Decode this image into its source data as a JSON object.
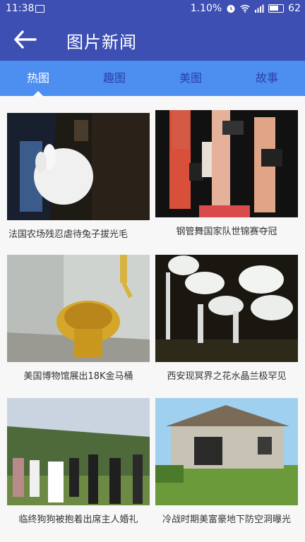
{
  "status_bar": {
    "time": "11:38",
    "network_speed": "1.10%",
    "battery_level": "62",
    "icons": [
      "image-icon",
      "alarm-icon",
      "wifi-icon",
      "signal-icon",
      "battery-icon"
    ]
  },
  "appbar": {
    "title": "图片新闻",
    "back_icon": "back-arrow-icon"
  },
  "tabs": [
    {
      "label": "热图",
      "active": true
    },
    {
      "label": "趣图",
      "active": false
    },
    {
      "label": "美图",
      "active": false
    },
    {
      "label": "故事",
      "active": false
    }
  ],
  "news": [
    {
      "caption": "法国农场残忍虐待兔子拔光毛"
    },
    {
      "caption": "钢管舞国家队世锦赛夺冠"
    },
    {
      "caption": "美国博物馆展出18K金马桶"
    },
    {
      "caption": "西安现冥界之花水晶兰极罕见"
    },
    {
      "caption": "临终狗狗被抱着出席主人婚礼"
    },
    {
      "caption": "冷战时期美富豪地下防空洞曝光"
    }
  ],
  "colors": {
    "primary": "#3d4fb3",
    "tab_bar": "#4d8ff0",
    "tab_inactive_text": "#2d3fa8"
  }
}
